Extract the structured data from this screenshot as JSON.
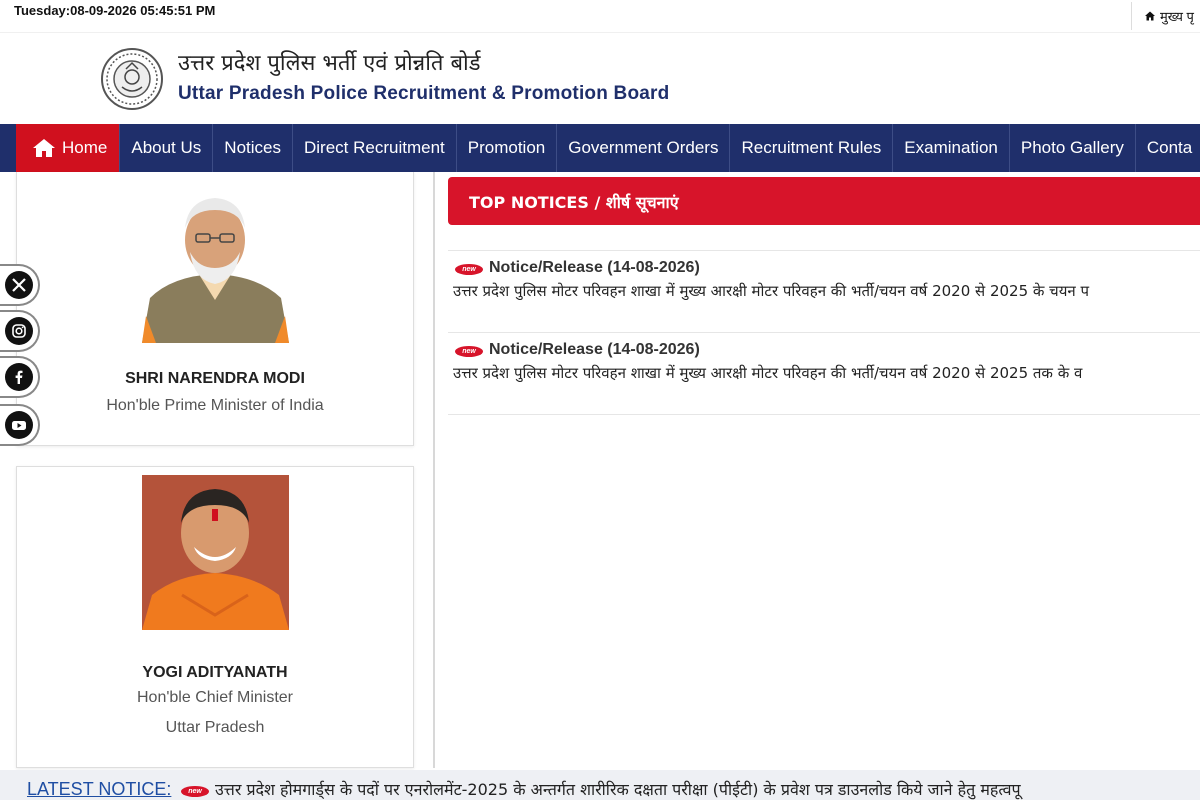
{
  "topbar": {
    "datetime": "Tuesday:08-09-2026 05:45:51 PM",
    "home_link": "मुख्य पृ"
  },
  "header": {
    "title_hi": "उत्तर प्रदेश पुलिस भर्ती एवं प्रोन्नति बोर्ड",
    "title_en": "Uttar Pradesh Police Recruitment & Promotion Board"
  },
  "nav": {
    "items": [
      "Home",
      "About Us",
      "Notices",
      "Direct Recruitment",
      "Promotion",
      "Government Orders",
      "Recruitment Rules",
      "Examination",
      "Photo Gallery",
      "Conta"
    ]
  },
  "leaders": [
    {
      "name": "SHRI NARENDRA MODI",
      "role": "Hon'ble Prime Minister of India"
    },
    {
      "name": "YOGI ADITYANATH",
      "role": "Hon'ble Chief Minister",
      "place": "Uttar Pradesh"
    }
  ],
  "social": [
    "x-icon",
    "instagram-icon",
    "facebook-icon",
    "youtube-icon"
  ],
  "top_notices": {
    "heading": "TOP NOTICES / शीर्ष सूचनाएं",
    "badge": "new",
    "items": [
      {
        "title": "Notice/Release (14-08-2026)",
        "text": "उत्तर प्रदेश पुलिस मोटर परिवहन शाखा में मुख्य आरक्षी मोटर परिवहन की भर्ती/चयन वर्ष 2020 से 2025 के चयन प"
      },
      {
        "title": "Notice/Release (14-08-2026)",
        "text": "उत्तर प्रदेश पुलिस मोटर परिवहन शाखा में मुख्य आरक्षी मोटर परिवहन की भर्ती/चयन वर्ष 2020 से 2025 तक के व"
      }
    ]
  },
  "ticker": {
    "label": "LATEST NOTICE:",
    "badge": "new",
    "text": "उत्तर प्रदेश होमगार्ड्स के पदों पर एनरोलमेंट-2025 के अन्तर्गत शारीरिक दक्षता परीक्षा (पीईटी) के प्रवेश पत्र डाउनलोड किये जाने हेतु महत्वपू"
  },
  "colors": {
    "nav_bg": "#1f2f6b",
    "accent_red": "#d7142a",
    "link_blue": "#1f4ea3"
  }
}
